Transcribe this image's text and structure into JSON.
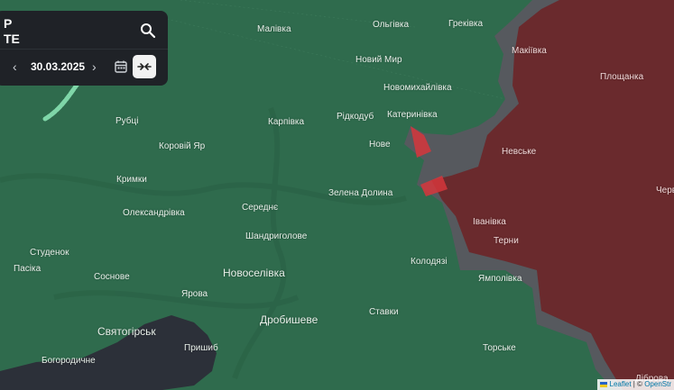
{
  "panel": {
    "title_line1": "Р",
    "title_line2": "ТЕ",
    "date": "30.03.2025",
    "prev_symbol": "‹",
    "next_symbol": "›"
  },
  "places": {
    "malivka": "Малівка",
    "olhivka": "Ольгівка",
    "hrekivka": "Греківка",
    "makiivka": "Макіївка",
    "ploshchanka": "Площанка",
    "novyi_myr": "Новий Мир",
    "novomykhailivka": "Новомихайлівка",
    "rubtsi": "Рубці",
    "karpivka": "Карпівка",
    "ridkodub": "Рідкодуб",
    "katerynivka": "Катеринівка",
    "koroviy_yar": "Коровій Яр",
    "nove": "Нове",
    "nevske": "Невське",
    "kryimky": "Кримки",
    "zelena_dolyna": "Зелена Долина",
    "cherv": "Черв",
    "oleksandrivka": "Олександрівка",
    "seredne": "Середнє",
    "ivanivka": "Іванівка",
    "shandryholove": "Шандриголове",
    "terny": "Терни",
    "studenok": "Студенок",
    "kolodiazi": "Колодязі",
    "pasika": "Пасіка",
    "sosnove": "Соснове",
    "novoselivka": "Новоселівка",
    "yampolivka": "Ямполівка",
    "yarova": "Ярова",
    "drobysheve": "Дробишеве",
    "stavky": "Ставки",
    "sviatohirsk": "Святогірськ",
    "pryshyb": "Пришиб",
    "torske": "Торське",
    "bohorodychne": "Богородичне",
    "dibrova": "Діброва"
  },
  "attribution": {
    "leaflet": "Leaflet",
    "separator": " | © ",
    "osm": "OpenStr"
  },
  "colors": {
    "ukraine_controlled": "#2f6b4d",
    "occupied": "#6a2a2d",
    "contested_gray": "#56595e",
    "dark_zone": "#2c3039",
    "road_green": "#7fd6a8",
    "attack_red": "#d6363c"
  }
}
